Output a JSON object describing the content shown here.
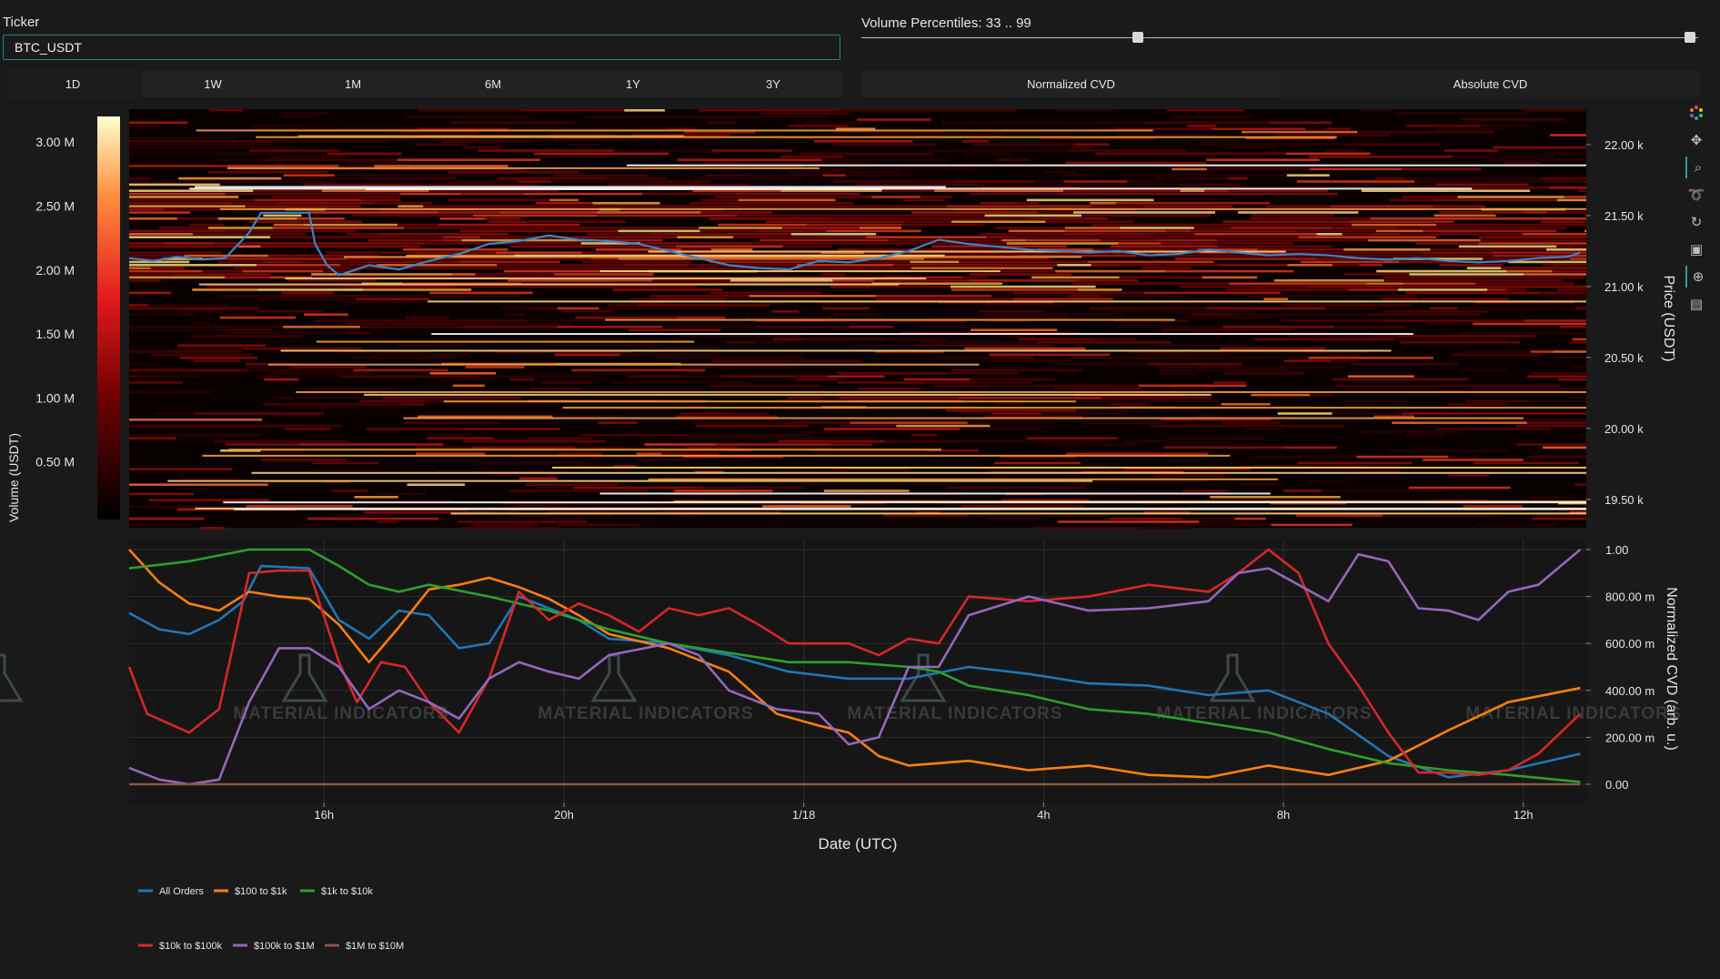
{
  "ticker": {
    "label": "Ticker",
    "value": "BTC_USDT"
  },
  "timeframes": [
    "1D",
    "1W",
    "1M",
    "6M",
    "1Y",
    "3Y"
  ],
  "percentiles": {
    "label": "Volume Percentiles: 33 .. 99",
    "low": 33,
    "high": 99
  },
  "cvd_modes": [
    "Normalized CVD",
    "Absolute CVD"
  ],
  "toolbar_icons": [
    "plotly-logo-icon",
    "pan-icon",
    "zoom-icon",
    "lasso-icon",
    "reset-icon",
    "save-icon",
    "crosshair-icon",
    "comment-icon"
  ],
  "watermark": "MATERIAL INDICATORS",
  "colors": {
    "All Orders": "#1f77b4",
    "$100 to $1k": "#ff7f0e",
    "$1k to $10k": "#2ca02c",
    "$10k to $100k": "#d62728",
    "$100k to $1M": "#9467bd",
    "$1M to $10M": "#8c564b"
  },
  "chart_data": [
    {
      "type": "heatmap",
      "ylabel": "Price (USDT)",
      "ylim": [
        19300,
        22250
      ],
      "yticks": [
        "19.50 k",
        "20.00 k",
        "20.50 k",
        "21.00 k",
        "21.50 k",
        "22.00 k"
      ],
      "ytick_values": [
        19500,
        20000,
        20500,
        21000,
        21500,
        22000
      ],
      "colorbar": {
        "label": "Volume (USDT)",
        "ticks": [
          "0.50 M",
          "1.00 M",
          "1.50 M",
          "2.00 M",
          "2.50 M",
          "3.00 M"
        ],
        "tick_values": [
          0.5,
          1.0,
          1.5,
          2.0,
          2.5,
          3.0
        ],
        "range": [
          0.05,
          3.2
        ]
      },
      "price_series": [
        [
          0,
          21200
        ],
        [
          0.4,
          21180
        ],
        [
          0.8,
          21210
        ],
        [
          1.2,
          21190
        ],
        [
          1.6,
          21200
        ],
        [
          2.0,
          21380
        ],
        [
          2.2,
          21520
        ],
        [
          2.6,
          21520
        ],
        [
          3.0,
          21520
        ],
        [
          3.1,
          21300
        ],
        [
          3.3,
          21150
        ],
        [
          3.5,
          21080
        ],
        [
          4.0,
          21150
        ],
        [
          4.5,
          21120
        ],
        [
          5.0,
          21180
        ],
        [
          5.5,
          21230
        ],
        [
          6.0,
          21300
        ],
        [
          6.5,
          21320
        ],
        [
          7.0,
          21360
        ],
        [
          7.5,
          21330
        ],
        [
          8.0,
          21320
        ],
        [
          8.5,
          21300
        ],
        [
          9.0,
          21250
        ],
        [
          9.5,
          21200
        ],
        [
          10.0,
          21150
        ],
        [
          10.5,
          21130
        ],
        [
          11.0,
          21120
        ],
        [
          11.5,
          21180
        ],
        [
          12.0,
          21170
        ],
        [
          12.5,
          21200
        ],
        [
          13.0,
          21250
        ],
        [
          13.5,
          21330
        ],
        [
          14.0,
          21300
        ],
        [
          14.5,
          21280
        ],
        [
          15.0,
          21260
        ],
        [
          15.5,
          21250
        ],
        [
          16.0,
          21240
        ],
        [
          16.5,
          21250
        ],
        [
          17.0,
          21220
        ],
        [
          17.5,
          21230
        ],
        [
          18.0,
          21260
        ],
        [
          18.5,
          21240
        ],
        [
          19.0,
          21220
        ],
        [
          19.5,
          21230
        ],
        [
          20.0,
          21220
        ],
        [
          20.5,
          21200
        ],
        [
          21.0,
          21190
        ],
        [
          21.5,
          21200
        ],
        [
          22.0,
          21180
        ],
        [
          22.5,
          21170
        ],
        [
          23.0,
          21180
        ],
        [
          23.5,
          21200
        ],
        [
          24.0,
          21210
        ],
        [
          24.2,
          21240
        ]
      ]
    },
    {
      "type": "line",
      "xlabel": "Date (UTC)",
      "ylabel": "Normalized CVD (arb. u.)",
      "xlim": [
        0,
        24.3
      ],
      "ylim": [
        0,
        1
      ],
      "xticks": [
        "16h",
        "20h",
        "1/18",
        "4h",
        "8h",
        "12h"
      ],
      "xtick_values": [
        3.25,
        7.25,
        11.25,
        15.25,
        19.25,
        23.25
      ],
      "yticks": [
        "0.00",
        "200.00 m",
        "400.00 m",
        "600.00 m",
        "800.00 m",
        "1.00"
      ],
      "ytick_values": [
        0,
        0.2,
        0.4,
        0.6,
        0.8,
        1.0
      ],
      "legend_position": "bottom-left",
      "series": [
        {
          "name": "All Orders",
          "points": [
            [
              0,
              0.73
            ],
            [
              0.5,
              0.66
            ],
            [
              1.0,
              0.64
            ],
            [
              1.5,
              0.7
            ],
            [
              1.9,
              0.78
            ],
            [
              2.2,
              0.93
            ],
            [
              3.0,
              0.92
            ],
            [
              3.5,
              0.7
            ],
            [
              4.0,
              0.62
            ],
            [
              4.5,
              0.74
            ],
            [
              5.0,
              0.72
            ],
            [
              5.5,
              0.58
            ],
            [
              6.0,
              0.6
            ],
            [
              6.5,
              0.8
            ],
            [
              7.0,
              0.75
            ],
            [
              7.5,
              0.7
            ],
            [
              8.0,
              0.62
            ],
            [
              9.0,
              0.6
            ],
            [
              10.0,
              0.55
            ],
            [
              11.0,
              0.48
            ],
            [
              12.0,
              0.45
            ],
            [
              13.0,
              0.45
            ],
            [
              14.0,
              0.5
            ],
            [
              15.0,
              0.47
            ],
            [
              16.0,
              0.43
            ],
            [
              17.0,
              0.42
            ],
            [
              18.0,
              0.38
            ],
            [
              19.0,
              0.4
            ],
            [
              20.0,
              0.3
            ],
            [
              21.0,
              0.12
            ],
            [
              22.0,
              0.03
            ],
            [
              23.0,
              0.06
            ],
            [
              24.2,
              0.13
            ]
          ]
        },
        {
          "name": "$100 to $1k",
          "points": [
            [
              0,
              1.0
            ],
            [
              0.5,
              0.86
            ],
            [
              1.0,
              0.77
            ],
            [
              1.5,
              0.74
            ],
            [
              2.0,
              0.82
            ],
            [
              2.5,
              0.8
            ],
            [
              3.0,
              0.79
            ],
            [
              3.5,
              0.68
            ],
            [
              4.0,
              0.52
            ],
            [
              4.5,
              0.67
            ],
            [
              5.0,
              0.83
            ],
            [
              5.5,
              0.85
            ],
            [
              6.0,
              0.88
            ],
            [
              6.5,
              0.84
            ],
            [
              7.0,
              0.79
            ],
            [
              7.5,
              0.72
            ],
            [
              8.0,
              0.64
            ],
            [
              9.0,
              0.58
            ],
            [
              10.0,
              0.48
            ],
            [
              10.8,
              0.3
            ],
            [
              11.5,
              0.25
            ],
            [
              12.0,
              0.22
            ],
            [
              12.5,
              0.12
            ],
            [
              13.0,
              0.08
            ],
            [
              14.0,
              0.1
            ],
            [
              15.0,
              0.06
            ],
            [
              16.0,
              0.08
            ],
            [
              17.0,
              0.04
            ],
            [
              18.0,
              0.03
            ],
            [
              19.0,
              0.08
            ],
            [
              20.0,
              0.04
            ],
            [
              21.0,
              0.1
            ],
            [
              22.0,
              0.23
            ],
            [
              23.0,
              0.35
            ],
            [
              24.2,
              0.41
            ]
          ]
        },
        {
          "name": "$1k to $10k",
          "points": [
            [
              0,
              0.92
            ],
            [
              1.0,
              0.95
            ],
            [
              2.0,
              1.0
            ],
            [
              3.0,
              1.0
            ],
            [
              3.5,
              0.93
            ],
            [
              4.0,
              0.85
            ],
            [
              4.5,
              0.82
            ],
            [
              5.0,
              0.85
            ],
            [
              6.0,
              0.8
            ],
            [
              7.0,
              0.74
            ],
            [
              7.5,
              0.7
            ],
            [
              8.0,
              0.66
            ],
            [
              9.0,
              0.6
            ],
            [
              10.0,
              0.56
            ],
            [
              11.0,
              0.52
            ],
            [
              12.0,
              0.52
            ],
            [
              13.0,
              0.5
            ],
            [
              13.5,
              0.48
            ],
            [
              14.0,
              0.42
            ],
            [
              15.0,
              0.38
            ],
            [
              16.0,
              0.32
            ],
            [
              17.0,
              0.3
            ],
            [
              18.0,
              0.26
            ],
            [
              19.0,
              0.22
            ],
            [
              20.0,
              0.15
            ],
            [
              21.0,
              0.09
            ],
            [
              22.0,
              0.06
            ],
            [
              23.0,
              0.04
            ],
            [
              24.2,
              0.01
            ]
          ]
        },
        {
          "name": "$10k to $100k",
          "points": [
            [
              0,
              0.5
            ],
            [
              0.3,
              0.3
            ],
            [
              1.0,
              0.22
            ],
            [
              1.5,
              0.32
            ],
            [
              2.0,
              0.9
            ],
            [
              2.5,
              0.91
            ],
            [
              3.0,
              0.91
            ],
            [
              3.5,
              0.52
            ],
            [
              3.8,
              0.35
            ],
            [
              4.2,
              0.52
            ],
            [
              4.6,
              0.5
            ],
            [
              5.0,
              0.35
            ],
            [
              5.5,
              0.22
            ],
            [
              6.0,
              0.45
            ],
            [
              6.5,
              0.82
            ],
            [
              7.0,
              0.7
            ],
            [
              7.5,
              0.77
            ],
            [
              8.0,
              0.72
            ],
            [
              8.5,
              0.65
            ],
            [
              9.0,
              0.75
            ],
            [
              9.5,
              0.72
            ],
            [
              10.0,
              0.75
            ],
            [
              10.5,
              0.68
            ],
            [
              11.0,
              0.6
            ],
            [
              12.0,
              0.6
            ],
            [
              12.5,
              0.55
            ],
            [
              13.0,
              0.62
            ],
            [
              13.5,
              0.6
            ],
            [
              14.0,
              0.8
            ],
            [
              15.0,
              0.78
            ],
            [
              16.0,
              0.8
            ],
            [
              17.0,
              0.85
            ],
            [
              18.0,
              0.82
            ],
            [
              18.5,
              0.9
            ],
            [
              19.0,
              1.0
            ],
            [
              19.5,
              0.9
            ],
            [
              20.0,
              0.6
            ],
            [
              20.5,
              0.42
            ],
            [
              21.0,
              0.22
            ],
            [
              21.5,
              0.05
            ],
            [
              22.0,
              0.05
            ],
            [
              22.5,
              0.04
            ],
            [
              23.0,
              0.06
            ],
            [
              23.5,
              0.13
            ],
            [
              24.2,
              0.3
            ]
          ]
        },
        {
          "name": "$100k to $1M",
          "points": [
            [
              0,
              0.07
            ],
            [
              0.5,
              0.02
            ],
            [
              1.0,
              0.0
            ],
            [
              1.5,
              0.02
            ],
            [
              2.0,
              0.35
            ],
            [
              2.5,
              0.58
            ],
            [
              3.0,
              0.58
            ],
            [
              3.5,
              0.5
            ],
            [
              4.0,
              0.32
            ],
            [
              4.5,
              0.4
            ],
            [
              5.0,
              0.35
            ],
            [
              5.5,
              0.28
            ],
            [
              6.0,
              0.45
            ],
            [
              6.5,
              0.52
            ],
            [
              7.0,
              0.48
            ],
            [
              7.5,
              0.45
            ],
            [
              8.0,
              0.55
            ],
            [
              9.0,
              0.6
            ],
            [
              9.5,
              0.55
            ],
            [
              10.0,
              0.4
            ],
            [
              10.8,
              0.32
            ],
            [
              11.5,
              0.3
            ],
            [
              12.0,
              0.17
            ],
            [
              12.5,
              0.2
            ],
            [
              13.0,
              0.5
            ],
            [
              13.5,
              0.5
            ],
            [
              14.0,
              0.72
            ],
            [
              15.0,
              0.8
            ],
            [
              16.0,
              0.74
            ],
            [
              17.0,
              0.75
            ],
            [
              18.0,
              0.78
            ],
            [
              18.5,
              0.9
            ],
            [
              19.0,
              0.92
            ],
            [
              20.0,
              0.78
            ],
            [
              20.5,
              0.98
            ],
            [
              21.0,
              0.95
            ],
            [
              21.5,
              0.75
            ],
            [
              22.0,
              0.74
            ],
            [
              22.5,
              0.7
            ],
            [
              23.0,
              0.82
            ],
            [
              23.5,
              0.85
            ],
            [
              24.2,
              1.0
            ]
          ]
        },
        {
          "name": "$1M to $10M",
          "points": [
            [
              0,
              0.0
            ],
            [
              24.2,
              0.0
            ]
          ]
        }
      ]
    }
  ]
}
